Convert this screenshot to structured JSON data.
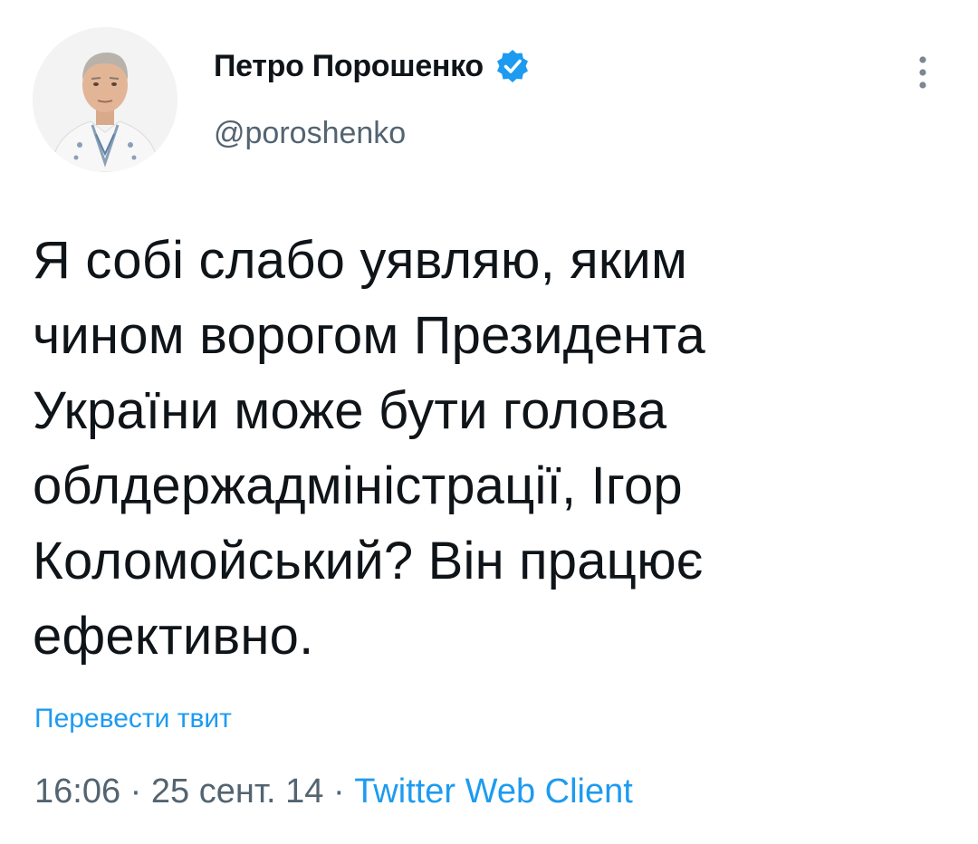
{
  "author": {
    "display_name": "Петро Порошенко",
    "handle": "@poroshenko",
    "verified": true,
    "avatar_icon": "profile-photo"
  },
  "tweet": {
    "lines": [
      "Я собі слабо уявляю, яким",
      "чином ворогом Президента",
      "України може бути голова",
      "облдержадміністрації, Ігор",
      "Коломойський? Він працює",
      "ефективно."
    ]
  },
  "actions": {
    "translate_label": "Перевести твит",
    "more_icon": "more-vertical-icon"
  },
  "meta": {
    "time": "16:06",
    "separator": "·",
    "date": "25 сент. 14",
    "source": "Twitter Web Client"
  },
  "colors": {
    "text": "#0f1419",
    "secondary": "#536471",
    "accent": "#1d9bf0",
    "background": "#ffffff"
  }
}
